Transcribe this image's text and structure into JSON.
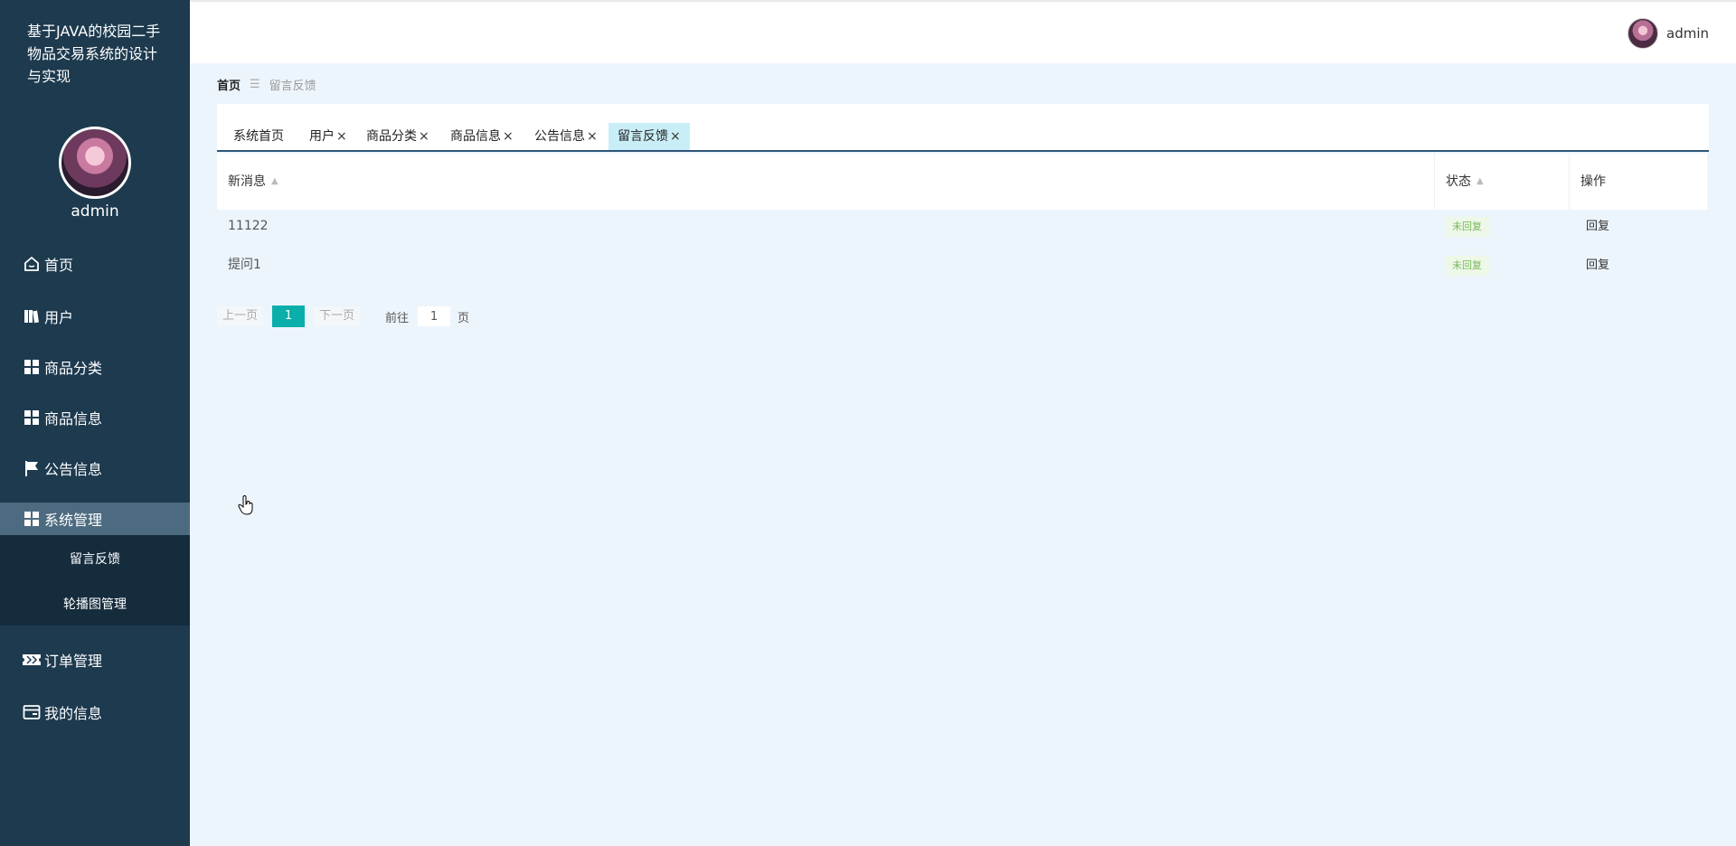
{
  "app": {
    "title": "基于JAVA的校园二手物品交易系统的设计与实现",
    "admin_name": "admin"
  },
  "sidebar": {
    "items": [
      {
        "label": "首页",
        "icon": "home-icon"
      },
      {
        "label": "用户",
        "icon": "book-icon"
      },
      {
        "label": "商品分类",
        "icon": "grid-icon"
      },
      {
        "label": "商品信息",
        "icon": "grid-icon"
      },
      {
        "label": "公告信息",
        "icon": "flag-icon"
      },
      {
        "label": "系统管理",
        "icon": "grid-icon"
      },
      {
        "label": "订单管理",
        "icon": "ticket-icon"
      },
      {
        "label": "我的信息",
        "icon": "card-icon"
      }
    ],
    "submenu": [
      "留言反馈",
      "轮播图管理"
    ]
  },
  "topbar": {
    "user": "admin"
  },
  "breadcrumb": {
    "home": "首页",
    "separator": "☰",
    "current": "留言反馈"
  },
  "tabs": [
    {
      "label": "系统首页",
      "closable": false
    },
    {
      "label": "用户",
      "closable": true
    },
    {
      "label": "商品分类",
      "closable": true
    },
    {
      "label": "商品信息",
      "closable": true
    },
    {
      "label": "公告信息",
      "closable": true
    },
    {
      "label": "留言反馈",
      "closable": true
    }
  ],
  "table": {
    "columns": [
      "新消息",
      "状态",
      "操作"
    ],
    "rows": [
      {
        "message": "11122",
        "status": "未回复",
        "action": "回复"
      },
      {
        "message": "提问1",
        "status": "未回复",
        "action": "回复"
      }
    ]
  },
  "pagination": {
    "prev": "上一页",
    "current": "1",
    "next": "下一页",
    "goto_label": "前往",
    "goto_value": "1",
    "unit": "页"
  },
  "colors": {
    "sidebar": "#1d3a4f",
    "accent": "#0aaeab",
    "active_tab": "#c9eef7",
    "status_text": "#78b85a"
  }
}
